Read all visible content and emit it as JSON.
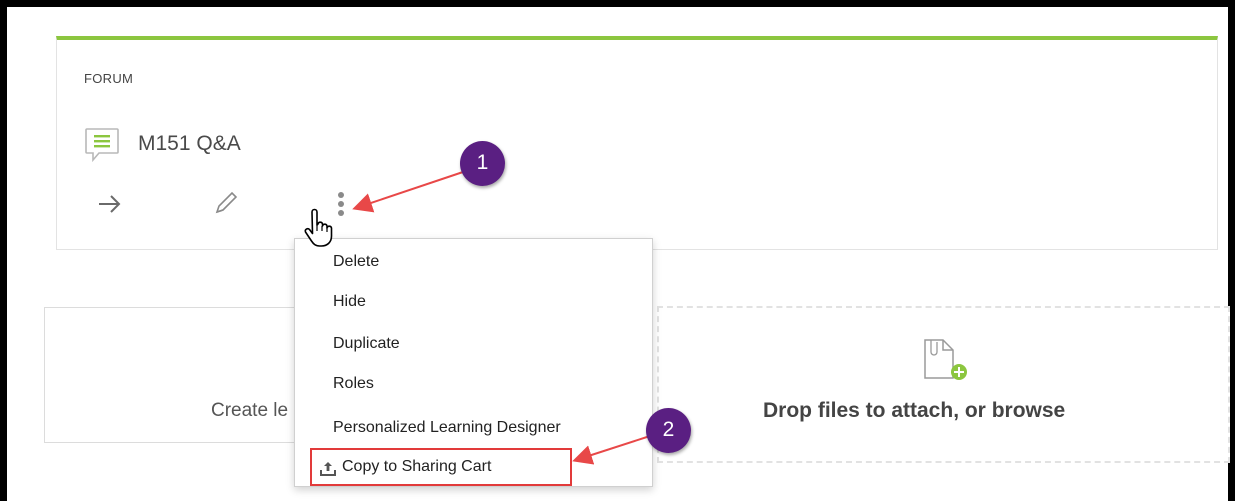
{
  "forum": {
    "section_label": "FORUM",
    "title": "M151 Q&A",
    "accent_color": "#8cc63f",
    "actions": {
      "open_icon": "arrow-right-icon",
      "edit_icon": "pencil-icon",
      "more_icon": "kebab-menu-icon"
    }
  },
  "create_card": {
    "text": "Create le"
  },
  "drop_zone": {
    "text": "Drop files to attach, or browse",
    "icon": "file-add-icon"
  },
  "context_menu": {
    "items": [
      {
        "label": "Delete"
      },
      {
        "label": "Hide"
      },
      {
        "label": "Duplicate"
      },
      {
        "label": "Roles"
      },
      {
        "label": "Personalized Learning Designer"
      },
      {
        "label": "Copy to Sharing Cart",
        "icon": "upload-tray-icon"
      }
    ],
    "highlight_color": "#e23a3a"
  },
  "annotations": {
    "badge_1": "1",
    "badge_2": "2",
    "badge_color": "#5a1f82",
    "arrow_color": "#e84848"
  }
}
